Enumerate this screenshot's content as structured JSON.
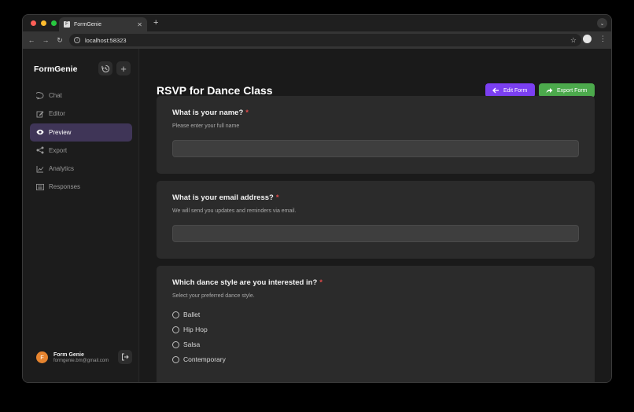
{
  "browser": {
    "tab_title": "FormGenie",
    "url": "localhost:58323"
  },
  "sidebar": {
    "brand": "FormGenie",
    "items": [
      {
        "label": "Chat",
        "icon": "chat-bubble-icon"
      },
      {
        "label": "Editor",
        "icon": "edit-icon"
      },
      {
        "label": "Preview",
        "icon": "eye-icon",
        "active": true
      },
      {
        "label": "Export",
        "icon": "share-icon"
      },
      {
        "label": "Analytics",
        "icon": "chart-line-icon"
      },
      {
        "label": "Responses",
        "icon": "list-icon"
      }
    ],
    "user": {
      "initial": "F",
      "name": "Form Genie",
      "email": "formgenie.bm@gmail.com"
    }
  },
  "main": {
    "title": "RSVP for Dance Class",
    "edit_label": "Edit Form",
    "export_label": "Export Form",
    "questions": [
      {
        "title": "What is your name?",
        "required": "*",
        "help": "Please enter your full name"
      },
      {
        "title": "What is your email address?",
        "required": "*",
        "help": "We will send you updates and reminders via email."
      },
      {
        "title": "Which dance style are you interested in?",
        "required": "*",
        "help": "Select your preferred dance style.",
        "options": [
          "Ballet",
          "Hip Hop",
          "Salsa",
          "Contemporary"
        ]
      }
    ]
  },
  "colors": {
    "accent_purple": "#7b3ff2",
    "accent_green": "#4caa4c",
    "required_red": "#e24a4a",
    "active_nav": "#3f3557"
  }
}
